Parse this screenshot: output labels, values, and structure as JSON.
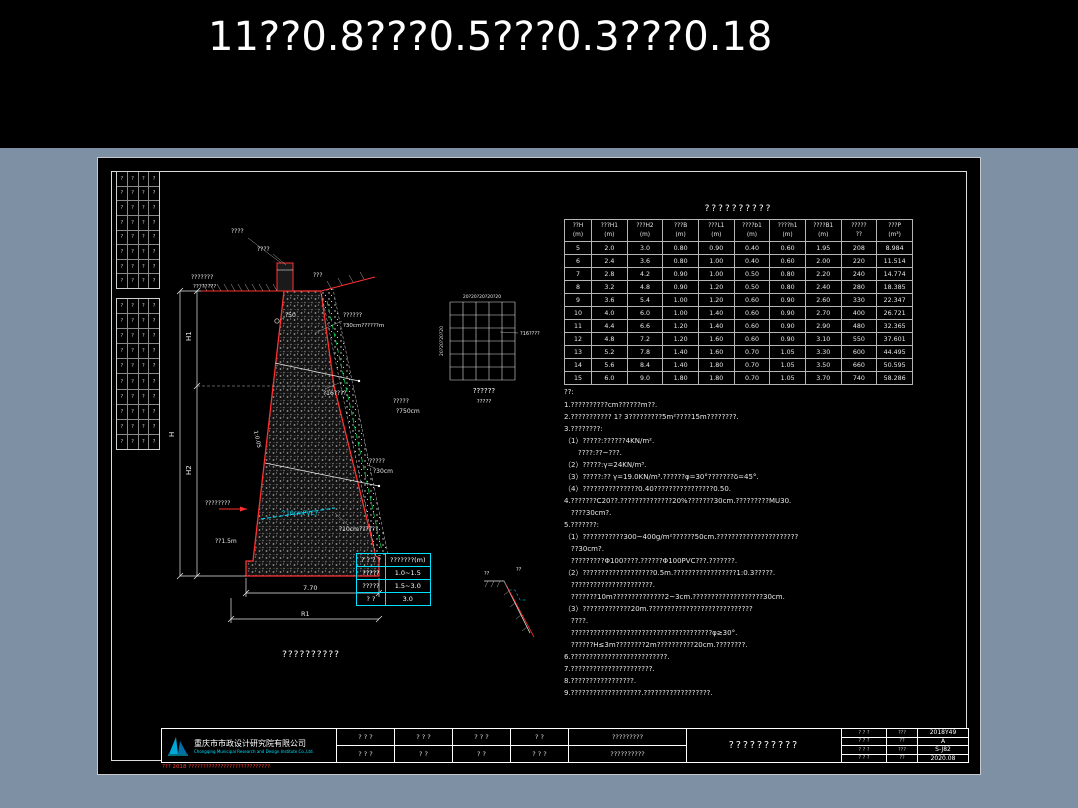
{
  "banner": {
    "title": "11??0.8???0.5???0.3???0.18"
  },
  "section": {
    "caption": "??????????",
    "labels": {
      "top1": "????",
      "top2": "????",
      "left1": "???????",
      "left2": "????????",
      "right_top": "???",
      "d50": "?50",
      "weep1": "??????",
      "weep2": "?30cm??????m",
      "anchor": "?16????",
      "filter1": "?????",
      "filter2": "?30cm",
      "free1": "?????",
      "free2": "?750cm",
      "embed": "????????",
      "embed_depth": "??1.5m",
      "pvc": "^10cmPVC?",
      "gravel": "?10cm??????",
      "slope": "1:0.05",
      "dim_h1": "H1",
      "dim_h2": "H2",
      "dim_h": "H",
      "dim_base": "7.70",
      "dim_r1": "R1"
    }
  },
  "mesh": {
    "top_ticks": "20?20?20?20?20",
    "left_ticks": "20?20?20?20",
    "bar_label": "?16????",
    "caption1": "??????",
    "caption2": "?????"
  },
  "sketch": {
    "label1": "??",
    "label2": "??"
  },
  "basis_table": {
    "headers": [
      "? ? ? ?",
      "???????(m)"
    ],
    "rows": [
      [
        "?????",
        "1.0~1.5"
      ],
      [
        "?????",
        "1.5~3.0"
      ],
      [
        "? ?",
        "3.0"
      ]
    ]
  },
  "data_table": {
    "title": "??????????",
    "headers": [
      [
        "??H",
        "(m)"
      ],
      [
        "???H1",
        "(m)"
      ],
      [
        "???H2",
        "(m)"
      ],
      [
        "???B",
        "(m)"
      ],
      [
        "???L1",
        "(m)"
      ],
      [
        "????b1",
        "(m)"
      ],
      [
        "????h1",
        "(m)"
      ],
      [
        "????B1",
        "(m)"
      ],
      [
        "?????",
        "??"
      ],
      [
        "???P",
        "(m³)"
      ]
    ],
    "rows": [
      [
        "5",
        "2.0",
        "3.0",
        "0.80",
        "0.90",
        "0.40",
        "0.60",
        "1.95",
        "208",
        "8.984"
      ],
      [
        "6",
        "2.4",
        "3.6",
        "0.80",
        "1.00",
        "0.40",
        "0.60",
        "2.00",
        "220",
        "11.514"
      ],
      [
        "7",
        "2.8",
        "4.2",
        "0.90",
        "1.00",
        "0.50",
        "0.80",
        "2.20",
        "240",
        "14.774"
      ],
      [
        "8",
        "3.2",
        "4.8",
        "0.90",
        "1.20",
        "0.50",
        "0.80",
        "2.40",
        "280",
        "18.385"
      ],
      [
        "9",
        "3.6",
        "5.4",
        "1.00",
        "1.20",
        "0.60",
        "0.90",
        "2.60",
        "330",
        "22.347"
      ],
      [
        "10",
        "4.0",
        "6.0",
        "1.00",
        "1.40",
        "0.60",
        "0.90",
        "2.70",
        "400",
        "26.721"
      ],
      [
        "11",
        "4.4",
        "6.6",
        "1.20",
        "1.40",
        "0.60",
        "0.90",
        "2.90",
        "480",
        "32.365"
      ],
      [
        "12",
        "4.8",
        "7.2",
        "1.20",
        "1.60",
        "0.60",
        "0.90",
        "3.10",
        "550",
        "37.601"
      ],
      [
        "13",
        "5.2",
        "7.8",
        "1.40",
        "1.60",
        "0.70",
        "1.05",
        "3.30",
        "600",
        "44.495"
      ],
      [
        "14",
        "5.6",
        "8.4",
        "1.40",
        "1.80",
        "0.70",
        "1.05",
        "3.50",
        "660",
        "50.595"
      ],
      [
        "15",
        "6.0",
        "9.0",
        "1.80",
        "1.80",
        "0.70",
        "1.05",
        "3.70",
        "740",
        "58.286"
      ]
    ]
  },
  "notes": {
    "title": "??:",
    "lines": [
      "1.??????????cm??????m??.",
      "2.??????????? 1? 3?????????5m²????15m????????.",
      "3.????????:",
      "（1）?????:??????4KN/m².",
      "　　????:??~???.",
      "（2）?????:γ=24KN/m³.",
      "（3）?????:?? γ=19.0KN/m³.??????φ=30°???????δ=45°.",
      "（4）???????????????0.40????????????????0.50.",
      "4.???????C20??.??????????????20%???????30cm.?????????MU30.",
      "　????30cm?.",
      "5.???????:",
      "（1）???????????300~400g/m²??????50cm.??????????????????????",
      "　??30cm?.",
      "　?????????Φ100????.??????Φ100PVC???.???????.",
      "（2）???????????????????0.5m.?????????????????1:0.3?????.",
      "　??????????????????????.",
      "　???????10m??????????????2~3cm.???????????????????30cm.",
      "（3）?????????????20m.????????????????????????????",
      "　????.",
      "　??????????????????????????????????????φ≥30°.",
      "　??????H≤3m????????2m??????????20cm.????????.",
      "6.??????????????????????????.",
      "7.??????????????????????.",
      "8.?????????????????.",
      "9.???????????????????.??????????????????."
    ]
  },
  "titleblock": {
    "company_cn": "重庆市市政设计研究院有限公司",
    "company_en": "Chongqing Municipal Research and Design Institute Co.,Ltd.",
    "red_note": "??? 2018 ????????????????????????????",
    "pairs": [
      {
        "top": "? ? ?",
        "bottom": "? ? ?"
      },
      {
        "top": "? ? ?",
        "bottom": "? ?"
      },
      {
        "top": "? ? ?",
        "bottom": "? ?"
      },
      {
        "top": "? ?",
        "bottom": "? ? ?"
      }
    ],
    "project_top": "?????????",
    "project_bottom": "??????????",
    "drawing_title": "??????????",
    "right_rows": [
      {
        "label": "? ? ?",
        "key": "???",
        "value": "2018Y49"
      },
      {
        "label": "? ? ?",
        "key": "??",
        "value": "A"
      },
      {
        "label": "? ? ?",
        "key": "???",
        "value": "S-J82"
      },
      {
        "label": "? ? ?",
        "key": "??",
        "value": "2020.08"
      }
    ]
  },
  "left_tables": {
    "cell": "?",
    "cols": 4,
    "t1_rows": 8,
    "t2_rows": 10
  }
}
